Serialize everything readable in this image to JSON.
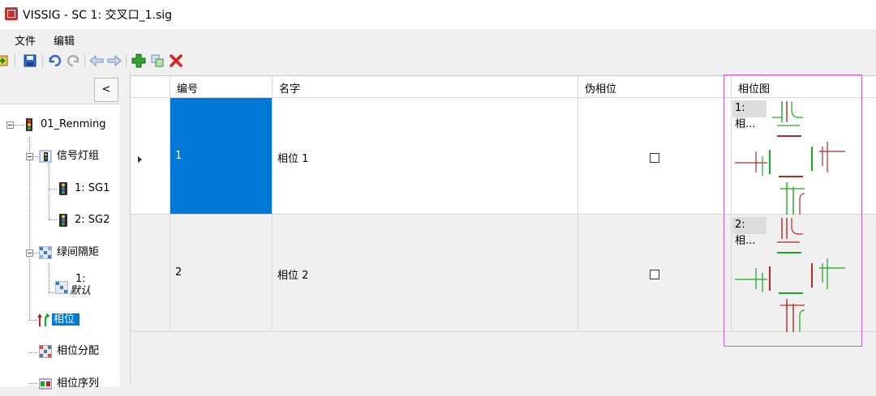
{
  "window": {
    "title": "VISSIG - SC 1: 交叉口_1.sig"
  },
  "menu": {
    "items": [
      "文件",
      "编辑"
    ]
  },
  "left": {
    "collapse_label": "<"
  },
  "tree": {
    "root": "01_Renming",
    "signal_groups": "信号灯组",
    "sg1": "1: SG1",
    "sg2": "2: SG2",
    "intergreens": "绿间隔矩",
    "intergreen_1_line1": "1:",
    "intergreen_1_line2": "默认",
    "phases": "相位",
    "phase_allocation": "相位分配",
    "phase_sequence": "相位序列"
  },
  "table": {
    "columns": [
      "编号",
      "名字",
      "伪相位",
      "相位图"
    ],
    "rows": [
      {
        "number": "1",
        "name": "相位 1",
        "pseudo": false,
        "diagram_label": "1: 相..."
      },
      {
        "number": "2",
        "name": "相位 2",
        "pseudo": false,
        "diagram_label": "2: 相..."
      }
    ]
  },
  "colors": {
    "selection": "#0078d7",
    "green_signal": "#1ca623",
    "red_signal": "#b42828",
    "highlight_box": "#d15ad8"
  }
}
